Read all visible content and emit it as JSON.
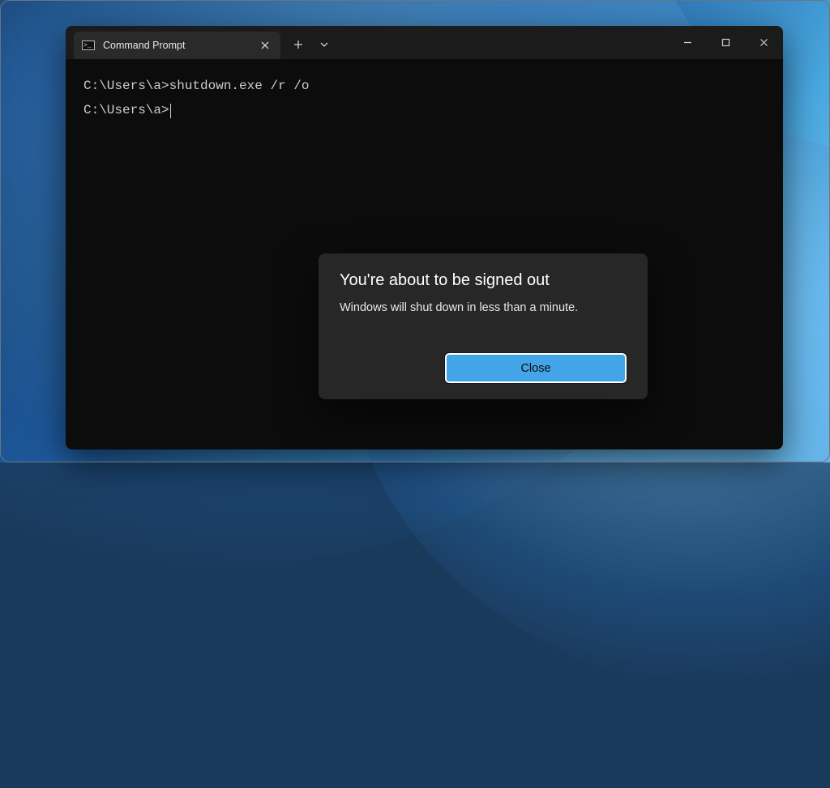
{
  "terminal": {
    "tab_title": "Command Prompt",
    "lines": [
      "C:\\Users\\a>shutdown.exe /r /o",
      "",
      "C:\\Users\\a>"
    ]
  },
  "dialog": {
    "title": "You're about to be signed out",
    "body": "Windows will shut down in less than a minute.",
    "close_label": "Close"
  }
}
